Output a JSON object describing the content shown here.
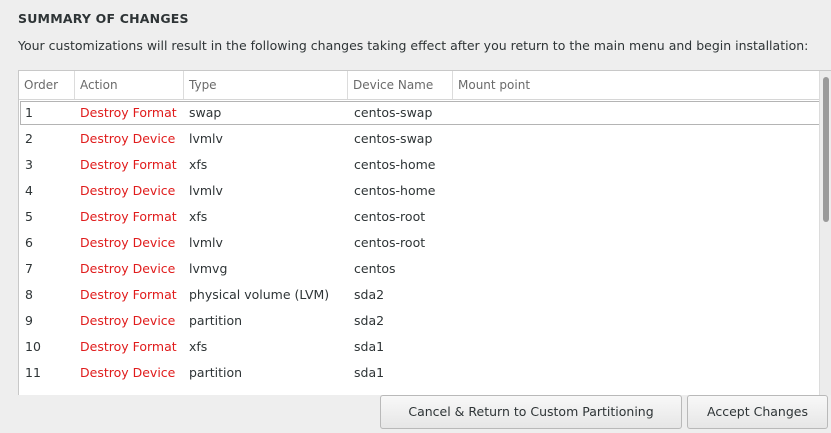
{
  "title": "SUMMARY OF CHANGES",
  "subtitle": "Your customizations will result in the following changes taking effect after you return to the main menu and begin installation:",
  "table": {
    "headers": [
      "Order",
      "Action",
      "Type",
      "Device Name",
      "Mount point"
    ],
    "rows": [
      {
        "order": "1",
        "action": "Destroy Format",
        "type": "swap",
        "device": "centos-swap",
        "mount": ""
      },
      {
        "order": "2",
        "action": "Destroy Device",
        "type": "lvmlv",
        "device": "centos-swap",
        "mount": ""
      },
      {
        "order": "3",
        "action": "Destroy Format",
        "type": "xfs",
        "device": "centos-home",
        "mount": ""
      },
      {
        "order": "4",
        "action": "Destroy Device",
        "type": "lvmlv",
        "device": "centos-home",
        "mount": ""
      },
      {
        "order": "5",
        "action": "Destroy Format",
        "type": "xfs",
        "device": "centos-root",
        "mount": ""
      },
      {
        "order": "6",
        "action": "Destroy Device",
        "type": "lvmlv",
        "device": "centos-root",
        "mount": ""
      },
      {
        "order": "7",
        "action": "Destroy Device",
        "type": "lvmvg",
        "device": "centos",
        "mount": ""
      },
      {
        "order": "8",
        "action": "Destroy Format",
        "type": "physical volume (LVM)",
        "device": "sda2",
        "mount": ""
      },
      {
        "order": "9",
        "action": "Destroy Device",
        "type": "partition",
        "device": "sda2",
        "mount": ""
      },
      {
        "order": "10",
        "action": "Destroy Format",
        "type": "xfs",
        "device": "sda1",
        "mount": ""
      },
      {
        "order": "11",
        "action": "Destroy Device",
        "type": "partition",
        "device": "sda1",
        "mount": ""
      }
    ]
  },
  "buttons": {
    "cancel": "Cancel & Return to Custom Partitioning",
    "accept": "Accept Changes"
  },
  "colors": {
    "action_text": "#e01b1b",
    "background": "#eeeeee"
  }
}
